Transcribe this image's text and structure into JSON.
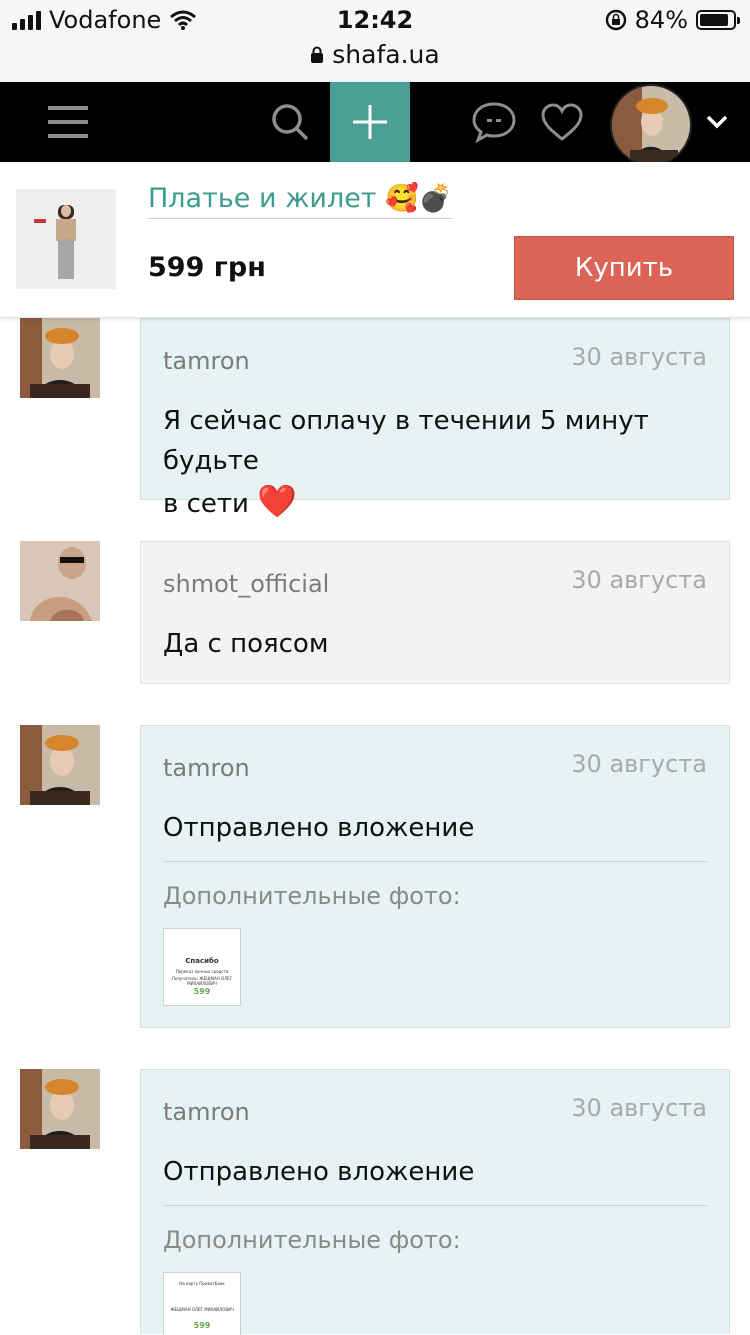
{
  "status_bar": {
    "carrier": "Vodafone",
    "time": "12:42",
    "battery": "84%",
    "url": "shafa.ua"
  },
  "product": {
    "title": "Платье и жилет 🥰💣",
    "price": "599 грн",
    "buy_label": "Купить"
  },
  "messages": [
    {
      "author": "tamron",
      "date": "30 августа",
      "text_line1": "Я сейчас оплачу в течении 5 минут будьте",
      "text_line2": "в сети",
      "heart": "❤️"
    },
    {
      "author": "shmot_official",
      "date": "30 августа",
      "text": "Да с поясом"
    },
    {
      "author": "tamron",
      "date": "30 августа",
      "text": "Отправлено вложение",
      "extra_label": "Дополнительные фото:",
      "attachment": {
        "line1": "Спасибо",
        "line2": "Переказ личных средств",
        "line3": "Получатель: ЖЕЩМАН ОЛЕГ МИХАЙЛОВИЧ",
        "amount": "599"
      }
    },
    {
      "author": "tamron",
      "date": "30 августа",
      "text": "Отправлено вложение",
      "extra_label": "Дополнительные фото:",
      "attachment": {
        "line1": "На карту ПриватБанк",
        "line2": "ЖЕЩМАН ОЛЕГ МИХАЙЛОВИЧ",
        "amount": "599"
      }
    }
  ],
  "colors": {
    "accent_teal": "#4a9e93",
    "title_teal": "#3d9b8d",
    "buy_red": "#db6456",
    "bubble_teal": "#e7f2f2",
    "bubble_grey": "#f3f3f3"
  }
}
